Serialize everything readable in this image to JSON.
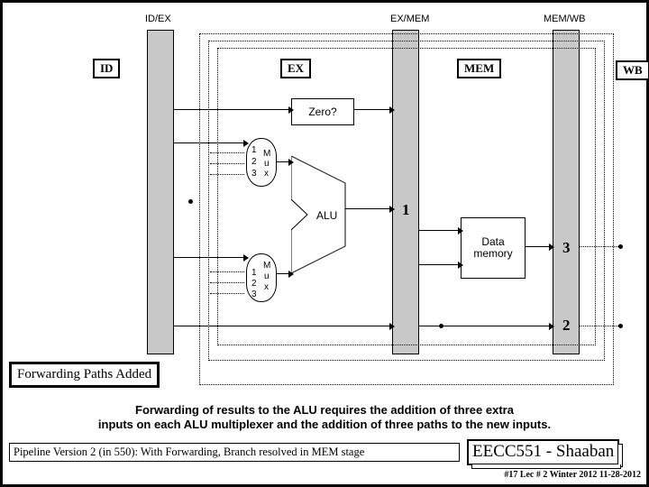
{
  "header": {
    "id_ex": "ID/EX",
    "ex_mem": "EX/MEM",
    "mem_wb": "MEM/WB"
  },
  "stage": {
    "id": "ID",
    "ex": "EX",
    "mem": "MEM",
    "wb": "WB"
  },
  "blocks": {
    "zero": "Zero?",
    "alu": "ALU",
    "dmem_l1": "Data",
    "dmem_l2": "memory"
  },
  "mux": {
    "top": {
      "n1": "1",
      "n2": "2",
      "n3": "3",
      "m": "M",
      "u": "u",
      "x": "x"
    },
    "bot": {
      "n1": "1",
      "n2": "2",
      "n3": "3",
      "m": "M",
      "u": "u",
      "x": "x"
    }
  },
  "bar_nums": {
    "exmem_1": "1",
    "memwb_3": "3",
    "memwb_2": "2"
  },
  "labels": {
    "fwd_box": "Forwarding Paths Added"
  },
  "body_text": {
    "l1": "Forwarding of results to the ALU requires the addition of three extra",
    "l2": "inputs on each ALU multiplexer and the addition of three paths to the new inputs."
  },
  "footer": {
    "desc": "Pipeline Version 2 (in 550): With Forwarding, Branch resolved in MEM stage",
    "course": "EECC551 - Shaaban",
    "meta": "#17   Lec # 2   Winter 2012    11-28-2012"
  },
  "chart_data": {
    "type": "pipeline-diagram",
    "stages": [
      "ID",
      "EX",
      "MEM",
      "WB"
    ],
    "pipeline_registers": [
      "ID/EX",
      "EX/MEM",
      "MEM/WB"
    ],
    "functional_units": [
      "Zero?",
      "ALU Mux (top, 3-input)",
      "ALU Mux (bottom, 3-input)",
      "ALU",
      "Data memory"
    ],
    "forwarding_labels": {
      "EX/MEM_out": 1,
      "MEM/WB_from_dmem": 3,
      "MEM/WB_passthrough": 2
    },
    "caption": "Forwarding of results to the ALU requires the addition of three extra inputs on each ALU multiplexer and the addition of three paths to the new inputs.",
    "title": "Pipeline Version 2 (in 550): With Forwarding, Branch resolved in MEM stage"
  }
}
